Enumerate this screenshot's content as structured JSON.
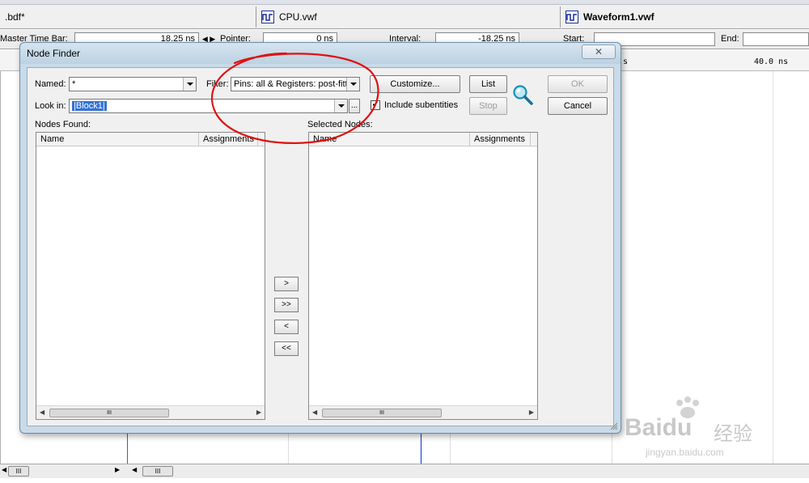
{
  "tabs": [
    {
      "label": ".bdf*",
      "bold": false
    },
    {
      "label": "CPU.vwf",
      "bold": false
    },
    {
      "label": "Waveform1.vwf",
      "bold": true
    }
  ],
  "timebar": {
    "master_label": "Master Time Bar:",
    "master_value": "18.25 ns",
    "pointer_label": "Pointer:",
    "pointer_value": "0 ns",
    "interval_label": "Interval:",
    "interval_value": "-18.25 ns",
    "start_label": "Start:",
    "start_value": "",
    "end_label": "End:",
    "end_value": ""
  },
  "ruler": {
    "right_label": "40.0 ns",
    "partial_label": "s"
  },
  "dialog": {
    "title": "Node Finder",
    "close_glyph": "✕",
    "named_label": "Named:",
    "named_value": "*",
    "filter_label": "Filter:",
    "filter_value": "Pins: all & Registers: post-fittin",
    "customize_label": "Customize...",
    "list_label": "List",
    "ok_label": "OK",
    "cancel_label": "Cancel",
    "look_in_label": "Look in:",
    "look_in_value": "|Block1|",
    "browse_label": "...",
    "include_subentities_label": "Include subentities",
    "include_subentities_checked": true,
    "stop_label": "Stop",
    "nodes_found_label": "Nodes Found:",
    "selected_nodes_label": "Selected Nodes:",
    "col_name": "Name",
    "col_assignments": "Assignments",
    "move_one_right": ">",
    "move_all_right": ">>",
    "move_one_left": "<",
    "move_all_left": "<<",
    "scroll_grip": "III"
  },
  "watermark": {
    "brand": "Baidu",
    "cn": "经验",
    "url": "jingyan.baidu.com"
  },
  "colors": {
    "dialog_frame": "#c9dbe8",
    "selection": "#3373d6",
    "annotation_red": "#e01010",
    "cursor_blue": "#1030d0"
  }
}
